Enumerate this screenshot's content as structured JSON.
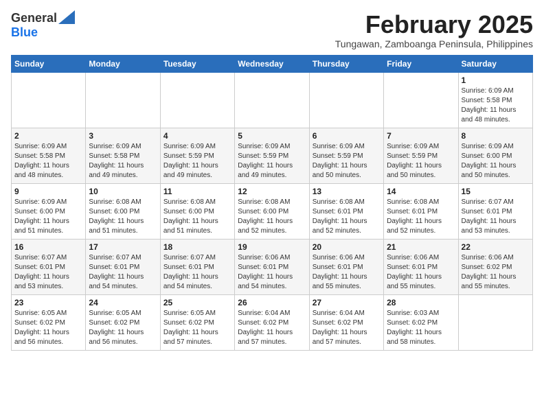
{
  "header": {
    "logo_general": "General",
    "logo_blue": "Blue",
    "title": "February 2025",
    "subtitle": "Tungawan, Zamboanga Peninsula, Philippines"
  },
  "days_of_week": [
    "Sunday",
    "Monday",
    "Tuesday",
    "Wednesday",
    "Thursday",
    "Friday",
    "Saturday"
  ],
  "weeks": [
    [
      {
        "day": "",
        "info": ""
      },
      {
        "day": "",
        "info": ""
      },
      {
        "day": "",
        "info": ""
      },
      {
        "day": "",
        "info": ""
      },
      {
        "day": "",
        "info": ""
      },
      {
        "day": "",
        "info": ""
      },
      {
        "day": "1",
        "info": "Sunrise: 6:09 AM\nSunset: 5:58 PM\nDaylight: 11 hours\nand 48 minutes."
      }
    ],
    [
      {
        "day": "2",
        "info": "Sunrise: 6:09 AM\nSunset: 5:58 PM\nDaylight: 11 hours\nand 48 minutes."
      },
      {
        "day": "3",
        "info": "Sunrise: 6:09 AM\nSunset: 5:58 PM\nDaylight: 11 hours\nand 49 minutes."
      },
      {
        "day": "4",
        "info": "Sunrise: 6:09 AM\nSunset: 5:59 PM\nDaylight: 11 hours\nand 49 minutes."
      },
      {
        "day": "5",
        "info": "Sunrise: 6:09 AM\nSunset: 5:59 PM\nDaylight: 11 hours\nand 49 minutes."
      },
      {
        "day": "6",
        "info": "Sunrise: 6:09 AM\nSunset: 5:59 PM\nDaylight: 11 hours\nand 50 minutes."
      },
      {
        "day": "7",
        "info": "Sunrise: 6:09 AM\nSunset: 5:59 PM\nDaylight: 11 hours\nand 50 minutes."
      },
      {
        "day": "8",
        "info": "Sunrise: 6:09 AM\nSunset: 6:00 PM\nDaylight: 11 hours\nand 50 minutes."
      }
    ],
    [
      {
        "day": "9",
        "info": "Sunrise: 6:09 AM\nSunset: 6:00 PM\nDaylight: 11 hours\nand 51 minutes."
      },
      {
        "day": "10",
        "info": "Sunrise: 6:08 AM\nSunset: 6:00 PM\nDaylight: 11 hours\nand 51 minutes."
      },
      {
        "day": "11",
        "info": "Sunrise: 6:08 AM\nSunset: 6:00 PM\nDaylight: 11 hours\nand 51 minutes."
      },
      {
        "day": "12",
        "info": "Sunrise: 6:08 AM\nSunset: 6:00 PM\nDaylight: 11 hours\nand 52 minutes."
      },
      {
        "day": "13",
        "info": "Sunrise: 6:08 AM\nSunset: 6:01 PM\nDaylight: 11 hours\nand 52 minutes."
      },
      {
        "day": "14",
        "info": "Sunrise: 6:08 AM\nSunset: 6:01 PM\nDaylight: 11 hours\nand 52 minutes."
      },
      {
        "day": "15",
        "info": "Sunrise: 6:07 AM\nSunset: 6:01 PM\nDaylight: 11 hours\nand 53 minutes."
      }
    ],
    [
      {
        "day": "16",
        "info": "Sunrise: 6:07 AM\nSunset: 6:01 PM\nDaylight: 11 hours\nand 53 minutes."
      },
      {
        "day": "17",
        "info": "Sunrise: 6:07 AM\nSunset: 6:01 PM\nDaylight: 11 hours\nand 54 minutes."
      },
      {
        "day": "18",
        "info": "Sunrise: 6:07 AM\nSunset: 6:01 PM\nDaylight: 11 hours\nand 54 minutes."
      },
      {
        "day": "19",
        "info": "Sunrise: 6:06 AM\nSunset: 6:01 PM\nDaylight: 11 hours\nand 54 minutes."
      },
      {
        "day": "20",
        "info": "Sunrise: 6:06 AM\nSunset: 6:01 PM\nDaylight: 11 hours\nand 55 minutes."
      },
      {
        "day": "21",
        "info": "Sunrise: 6:06 AM\nSunset: 6:01 PM\nDaylight: 11 hours\nand 55 minutes."
      },
      {
        "day": "22",
        "info": "Sunrise: 6:06 AM\nSunset: 6:02 PM\nDaylight: 11 hours\nand 55 minutes."
      }
    ],
    [
      {
        "day": "23",
        "info": "Sunrise: 6:05 AM\nSunset: 6:02 PM\nDaylight: 11 hours\nand 56 minutes."
      },
      {
        "day": "24",
        "info": "Sunrise: 6:05 AM\nSunset: 6:02 PM\nDaylight: 11 hours\nand 56 minutes."
      },
      {
        "day": "25",
        "info": "Sunrise: 6:05 AM\nSunset: 6:02 PM\nDaylight: 11 hours\nand 57 minutes."
      },
      {
        "day": "26",
        "info": "Sunrise: 6:04 AM\nSunset: 6:02 PM\nDaylight: 11 hours\nand 57 minutes."
      },
      {
        "day": "27",
        "info": "Sunrise: 6:04 AM\nSunset: 6:02 PM\nDaylight: 11 hours\nand 57 minutes."
      },
      {
        "day": "28",
        "info": "Sunrise: 6:03 AM\nSunset: 6:02 PM\nDaylight: 11 hours\nand 58 minutes."
      },
      {
        "day": "",
        "info": ""
      }
    ]
  ]
}
